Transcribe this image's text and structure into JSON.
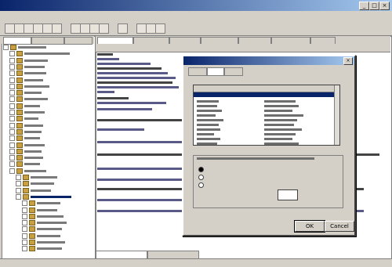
{
  "window": {
    "title": "",
    "controls": [
      "_",
      "□",
      "×"
    ]
  },
  "menubar": {
    "items": [
      "",
      "",
      "",
      "",
      "",
      "",
      "",
      ""
    ]
  },
  "toolbar": {
    "icons": [
      "new-icon",
      "open-icon",
      "save-icon",
      "print-icon",
      "cut-icon",
      "copy-icon",
      "paste-icon",
      "undo-icon",
      "redo-icon",
      "find-icon",
      "run-icon",
      "stop-icon",
      "debug-icon",
      "options-icon"
    ]
  },
  "left_panel": {
    "tabs": [
      "",
      "",
      ""
    ],
    "tree_nodes": [
      {
        "level": 0,
        "w": 36
      },
      {
        "level": 1,
        "w": 58
      },
      {
        "level": 1,
        "w": 30
      },
      {
        "level": 1,
        "w": 26
      },
      {
        "level": 1,
        "w": 28
      },
      {
        "level": 1,
        "w": 24
      },
      {
        "level": 1,
        "w": 32
      },
      {
        "level": 1,
        "w": 22
      },
      {
        "level": 1,
        "w": 30
      },
      {
        "level": 1,
        "w": 20
      },
      {
        "level": 1,
        "w": 26
      },
      {
        "level": 1,
        "w": 18
      },
      {
        "level": 1,
        "w": 24
      },
      {
        "level": 1,
        "w": 22
      },
      {
        "level": 1,
        "w": 20
      },
      {
        "level": 1,
        "w": 26
      },
      {
        "level": 1,
        "w": 22
      },
      {
        "level": 1,
        "w": 24
      },
      {
        "level": 1,
        "w": 20
      },
      {
        "level": 1,
        "w": 28
      },
      {
        "level": 2,
        "w": 34
      },
      {
        "level": 2,
        "w": 30
      },
      {
        "level": 2,
        "w": 26
      },
      {
        "level": 2,
        "w": 52,
        "selected": true
      },
      {
        "level": 3,
        "w": 30
      },
      {
        "level": 3,
        "w": 26
      },
      {
        "level": 3,
        "w": 34
      },
      {
        "level": 3,
        "w": 38
      },
      {
        "level": 3,
        "w": 32
      },
      {
        "level": 3,
        "w": 30
      },
      {
        "level": 3,
        "w": 36
      },
      {
        "level": 3,
        "w": 32
      }
    ]
  },
  "editor": {
    "tabs": [
      "",
      "",
      "",
      "",
      "",
      "",
      ""
    ],
    "subtoolbar": [
      ""
    ],
    "code_lines": [
      {
        "x": 0,
        "w": 20
      },
      {
        "x": 0,
        "w": 28
      },
      {
        "x": 0,
        "w": 68
      },
      {
        "x": 0,
        "w": 82
      },
      {
        "x": 0,
        "w": 90
      },
      {
        "x": 0,
        "w": 100
      },
      {
        "x": 0,
        "w": 96
      },
      {
        "x": 0,
        "w": 104
      },
      {
        "x": 0,
        "w": 22
      },
      {
        "x": 0,
        "w": 40
      },
      {
        "x": 0,
        "w": 88
      },
      {
        "x": 0,
        "w": 70
      },
      {
        "x": 0,
        "w": 240
      },
      {
        "x": 0,
        "w": 60
      },
      {
        "x": 0,
        "w": 130
      },
      {
        "x": 0,
        "w": 360
      },
      {
        "x": 0,
        "w": 300
      },
      {
        "x": 0,
        "w": 130
      },
      {
        "x": 0,
        "w": 340
      },
      {
        "x": 0,
        "w": 110
      },
      {
        "x": 0,
        "w": 340
      }
    ],
    "bottom_tabs": [
      "",
      ""
    ]
  },
  "dialog": {
    "title": "",
    "tabs": [
      "",
      "",
      ""
    ],
    "list": {
      "headers": [
        "",
        ""
      ],
      "rows": [
        {
          "a": 28,
          "b": 40
        },
        {
          "a": 26,
          "b": 44
        },
        {
          "a": 32,
          "b": 36
        },
        {
          "a": 24,
          "b": 50
        },
        {
          "a": 34,
          "b": 42
        },
        {
          "a": 28,
          "b": 38
        },
        {
          "a": 30,
          "b": 48
        },
        {
          "a": 22,
          "b": 40
        },
        {
          "a": 30,
          "b": 36
        },
        {
          "a": 26,
          "b": 44
        }
      ]
    },
    "group_label": "",
    "options": [
      "",
      "",
      "",
      ""
    ],
    "input_value": "",
    "ok_label": "OK",
    "cancel_label": "Cancel"
  },
  "statusbar": {
    "text": ""
  }
}
